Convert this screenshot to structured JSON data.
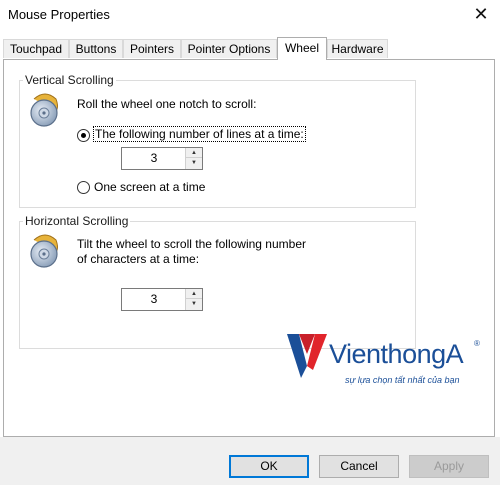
{
  "window": {
    "title": "Mouse Properties",
    "close_glyph": "✕"
  },
  "tabs": [
    {
      "label": "Touchpad",
      "active": false
    },
    {
      "label": "Buttons",
      "active": false
    },
    {
      "label": "Pointers",
      "active": false
    },
    {
      "label": "Pointer Options",
      "active": false
    },
    {
      "label": "Wheel",
      "active": true
    },
    {
      "label": "Hardware",
      "active": false
    }
  ],
  "vertical": {
    "title": "Vertical Scrolling",
    "intro": "Roll the wheel one notch to scroll:",
    "option_lines": "The following number of lines at a time:",
    "lines_value": "3",
    "option_screen": "One screen at a time",
    "selected": "lines"
  },
  "horizontal": {
    "title": "Horizontal Scrolling",
    "intro_line1": "Tilt the wheel to scroll the following number",
    "intro_line2": "of characters at a time:",
    "chars_value": "3"
  },
  "watermark": {
    "brand": "VienthongA",
    "registered": "®",
    "slogan": "sự lựa chọn tất nhất của bạn",
    "colors": {
      "red": "#e1252b",
      "blue": "#1b4f98"
    }
  },
  "buttons": {
    "ok": "OK",
    "cancel": "Cancel",
    "apply": "Apply"
  },
  "icons": {
    "spin_up": "▲",
    "spin_down": "▼"
  }
}
